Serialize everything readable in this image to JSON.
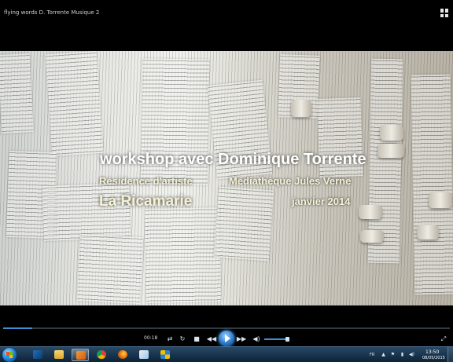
{
  "window": {
    "title": "flying words D. Torrente Musique 2",
    "switch_icon": "switch-to-library-icon"
  },
  "video": {
    "overlay": {
      "title": "workshop avec Dominique Torrente",
      "residence": "Résidence d'artiste",
      "venue": "Médiathèque Jules Verne",
      "place": "La Ricamarie",
      "date": "janvier 2014"
    }
  },
  "player": {
    "elapsed": "00:18",
    "seek_progress": 0.065,
    "volume_level": 0.9,
    "accent_color": "#3f8fd8",
    "buttons": {
      "shuffle_icon": "shuffle-icon",
      "repeat_icon": "repeat-icon",
      "stop_icon": "stop-icon",
      "previous_icon": "previous-icon",
      "play_icon": "play-icon",
      "next_icon": "next-icon",
      "mute_icon": "speaker-icon",
      "fullscreen_icon": "fullscreen-icon"
    }
  },
  "taskbar": {
    "apps": [
      {
        "icon": "windows-media-center-icon"
      },
      {
        "icon": "file-explorer-icon"
      },
      {
        "icon": "media-player-icon",
        "active": true
      },
      {
        "icon": "chrome-icon"
      },
      {
        "icon": "firefox-icon"
      },
      {
        "icon": "paint-icon"
      },
      {
        "icon": "security-shield-icon"
      }
    ],
    "language": "FR",
    "clock": {
      "time": "13:50",
      "date": "08/05/2015"
    }
  }
}
